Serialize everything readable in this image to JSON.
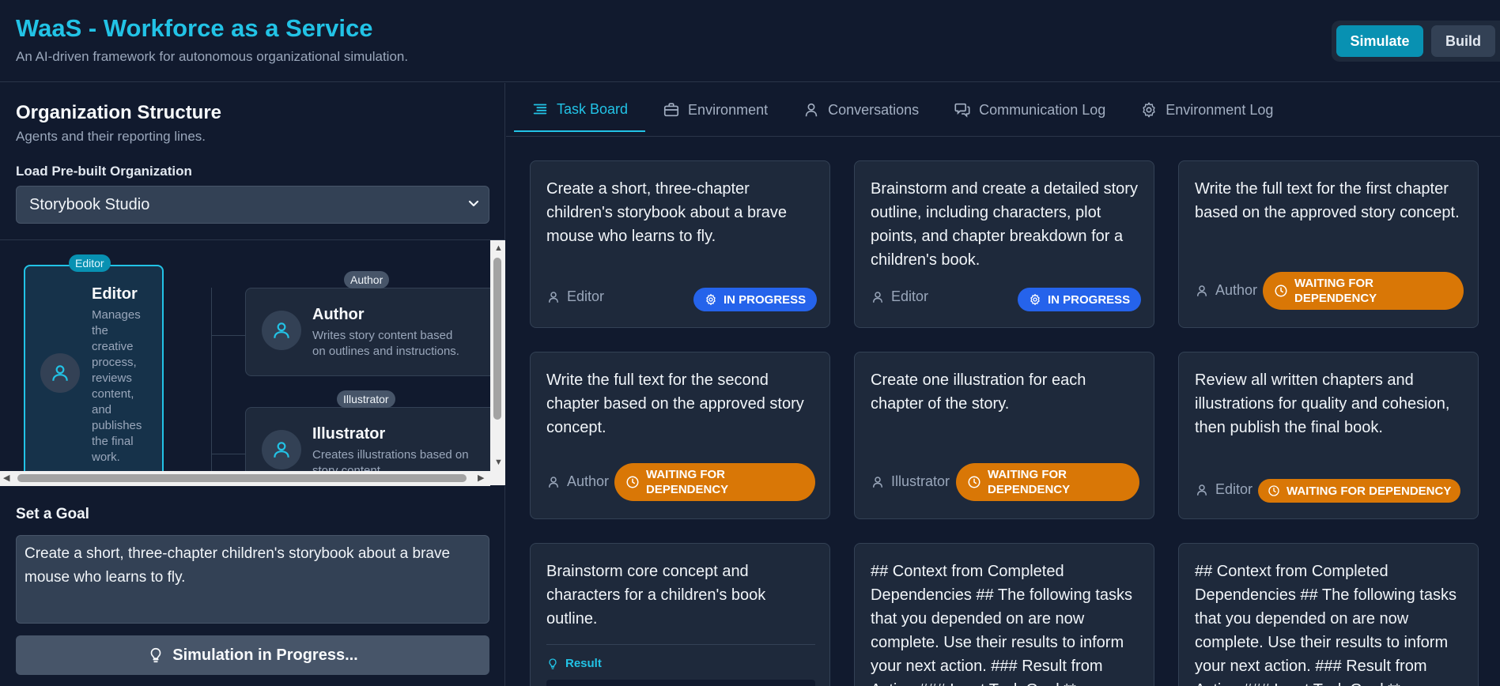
{
  "header": {
    "title": "WaaS - Workforce as a Service",
    "subtitle": "An AI-driven framework for autonomous organizational simulation.",
    "modes": {
      "simulate": "Simulate",
      "build": "Build",
      "active": "Simulate"
    }
  },
  "org": {
    "title": "Organization Structure",
    "subtitle": "Agents and their reporting lines.",
    "load_label": "Load Pre-built Organization",
    "selected": "Storybook Studio",
    "root": {
      "badge": "Editor",
      "name": "Editor",
      "desc_lines": [
        "Manages",
        "the",
        "creative",
        "process,",
        "reviews",
        "content,",
        "and",
        "publishes",
        "the final",
        "work."
      ]
    },
    "children": [
      {
        "badge": "Author",
        "name": "Author",
        "desc_lines": [
          "Writes story content based",
          "on outlines and instructions."
        ]
      },
      {
        "badge": "Illustrator",
        "name": "Illustrator",
        "desc_lines": [
          "Creates illustrations based on",
          "story content."
        ]
      }
    ]
  },
  "goal": {
    "label": "Set a Goal",
    "value": "Create a short, three-chapter children's storybook about a brave mouse who learns to fly.",
    "button": "Simulation in Progress..."
  },
  "tabs": [
    {
      "label": "Task Board",
      "icon": "list-icon",
      "active": true
    },
    {
      "label": "Environment",
      "icon": "briefcase-icon",
      "active": false
    },
    {
      "label": "Conversations",
      "icon": "user-icon",
      "active": false
    },
    {
      "label": "Communication Log",
      "icon": "chat-icon",
      "active": false
    },
    {
      "label": "Environment Log",
      "icon": "gear-icon",
      "active": false
    }
  ],
  "tasks": [
    {
      "text": "Create a short, three-chapter children's storybook about a brave mouse who learns to fly.",
      "assignee": "Editor",
      "status": "IN PROGRESS"
    },
    {
      "text": "Brainstorm and create a detailed story outline, including characters, plot points, and chapter breakdown for a children's book.",
      "assignee": "Editor",
      "status": "IN PROGRESS"
    },
    {
      "text": "Write the full text for the first chapter based on the approved story concept.",
      "assignee": "Author",
      "status_lines": [
        "WAITING FOR",
        "DEPENDENCY"
      ]
    },
    {
      "text": "Write the full text for the second chapter based on the approved story concept.",
      "assignee": "Author",
      "status_lines": [
        "WAITING FOR",
        "DEPENDENCY"
      ]
    },
    {
      "text": "Create one illustration for each chapter of the story.",
      "assignee": "Illustrator",
      "status_lines": [
        "WAITING FOR",
        "DEPENDENCY"
      ]
    },
    {
      "text": "Review all written chapters and illustrations for quality and cohesion, then publish the final book.",
      "assignee": "Editor",
      "status": "WAITING FOR DEPENDENCY"
    },
    {
      "text": "Brainstorm core concept and characters for a children's book outline.",
      "result_label": "Result"
    },
    {
      "text": "## Context from Completed Dependencies ## The following tasks that you depended on are now complete. Use their results to inform your next action. ### Result from Action ### Input Task Goal **"
    },
    {
      "text": "## Context from Completed Dependencies ## The following tasks that you depended on are now complete. Use their results to inform your next action. ### Result from Action ### Input Task Goal **"
    }
  ],
  "colors": {
    "accent": "#22c3e6",
    "in_progress": "#2563eb",
    "waiting": "#d97706",
    "background": "#111a2e",
    "card": "#1e293b"
  }
}
